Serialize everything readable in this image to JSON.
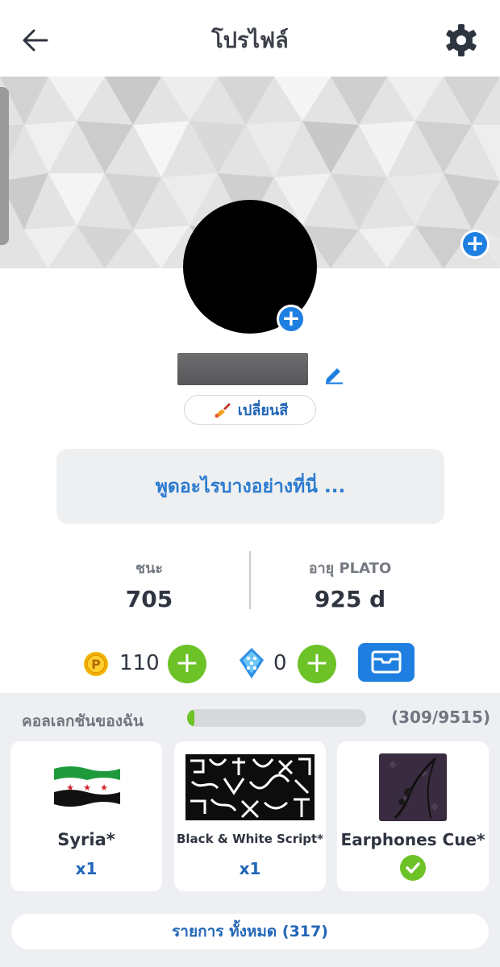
{
  "header": {
    "title": "โปรไฟล์",
    "back_icon": "arrow-left-icon",
    "settings_icon": "gear-icon"
  },
  "profile": {
    "change_color_label": "เปลี่ยนสี",
    "status_placeholder": "พูดอะไรบางอย่างที่นี่ ..."
  },
  "stats": [
    {
      "label": "ชนะ",
      "value": "705"
    },
    {
      "label": "อายุ PLATO",
      "value": "925 d"
    }
  ],
  "currency": {
    "coins": "110",
    "gems": "0"
  },
  "collection": {
    "title": "คอลเลกชันของฉัน",
    "progress_text": "(309/9515)",
    "progress_fraction": 0.0324,
    "items": [
      {
        "name": "Syria*",
        "qty": "x1"
      },
      {
        "name": "Black & White Script*",
        "qty": "x1"
      },
      {
        "name": "Earphones Cue*",
        "owned_check": true
      }
    ],
    "all_items_label": "รายการ ทั้งหมด (317)"
  },
  "colors": {
    "accent": "#1e7fe0",
    "green": "#6cc227",
    "link": "#2166b8"
  }
}
